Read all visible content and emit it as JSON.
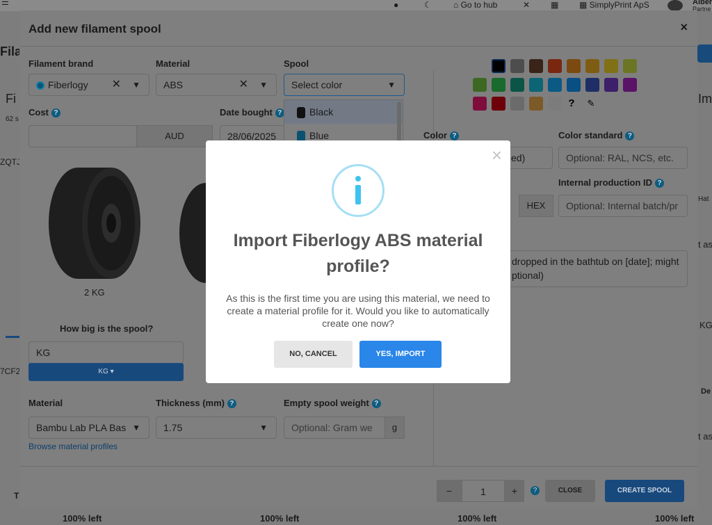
{
  "topbar": {
    "go_to_hub": "Go to hub",
    "org_name": "SimplyPrint ApS",
    "user_name": "Alber",
    "user_role": "Partne"
  },
  "background": {
    "left_texts": [
      "Fila",
      "Fi",
      "62 s",
      "ZQTJ",
      "7CF2",
      "T"
    ],
    "right_texts": [
      "Im",
      "Hat",
      "t as",
      "KG",
      "De",
      "t as"
    ],
    "bottom_items": [
      "100% left",
      "100% left",
      "100% left",
      "100% left"
    ]
  },
  "modal": {
    "title": "Add new filament spool",
    "close_label": "×",
    "filament_brand_label": "Filament brand",
    "filament_brand_value": "Fiberlogy",
    "material_label": "Material",
    "material_value": "ABS",
    "spool_label": "Spool",
    "spool_placeholder": "Select color",
    "spool_options": [
      "Black",
      "Blue"
    ],
    "cost_label": "Cost",
    "currency": "AUD",
    "date_bought_label": "Date bought",
    "date_bought_value": "28/06/2025",
    "spool_size_label": "2 KG",
    "how_big_label": "How big is the spool?",
    "weight_placeholder": "KG",
    "unit_button": "KG",
    "material2_label": "Material",
    "material2_value": "Bambu Lab PLA Bas",
    "thickness_label": "Thickness (mm)",
    "thickness_value": "1.75",
    "empty_weight_label": "Empty spool weight",
    "empty_weight_placeholder": "Optional: Gram we",
    "empty_weight_unit": "g",
    "browse_link": "Browse material profiles",
    "color_label": "Color",
    "color_value_partial": "ed)",
    "color_standard_label": "Color standard",
    "color_standard_placeholder": "Optional: RAL, NCS, etc.",
    "hex_label": "HEX",
    "internal_id_label": "Internal production ID",
    "internal_id_placeholder": "Optional: Internal batch/pr",
    "notes_partial_1": "dropped in the bathtub on [date]; might",
    "notes_partial_2": "ptional)",
    "unknown_color_label": "?",
    "quantity": "1",
    "minus": "−",
    "plus": "+",
    "close_button": "CLOSE",
    "create_button": "CREATE SPOOL"
  },
  "swatch_colors": [
    [
      "#7f7f7f",
      "#000000",
      "#4d4d4d",
      "#3a2318",
      "#7a2710",
      "#7c4a10",
      "#7e5d12",
      "#807016",
      "#6b7523"
    ],
    [
      "#3d6823",
      "#196a2d",
      "#0b5547",
      "#0b6574",
      "#0a5a85",
      "#0a4f84",
      "#1f2e66",
      "#3d1f6a",
      "#5a1366"
    ],
    [
      "#7f0d3c",
      "#6d0008",
      "#6b6b6b",
      "#7c5a28",
      "#7c7c7c"
    ]
  ],
  "dialog": {
    "title": "Import Fiberlogy ABS material profile?",
    "text": "As this is the first time you are using this material, we need to create a material profile for it. Would you like to automatically create one now?",
    "no_button": "NO, CANCEL",
    "yes_button": "YES, IMPORT",
    "close_label": "×",
    "icon_color": "#a5dff4"
  }
}
